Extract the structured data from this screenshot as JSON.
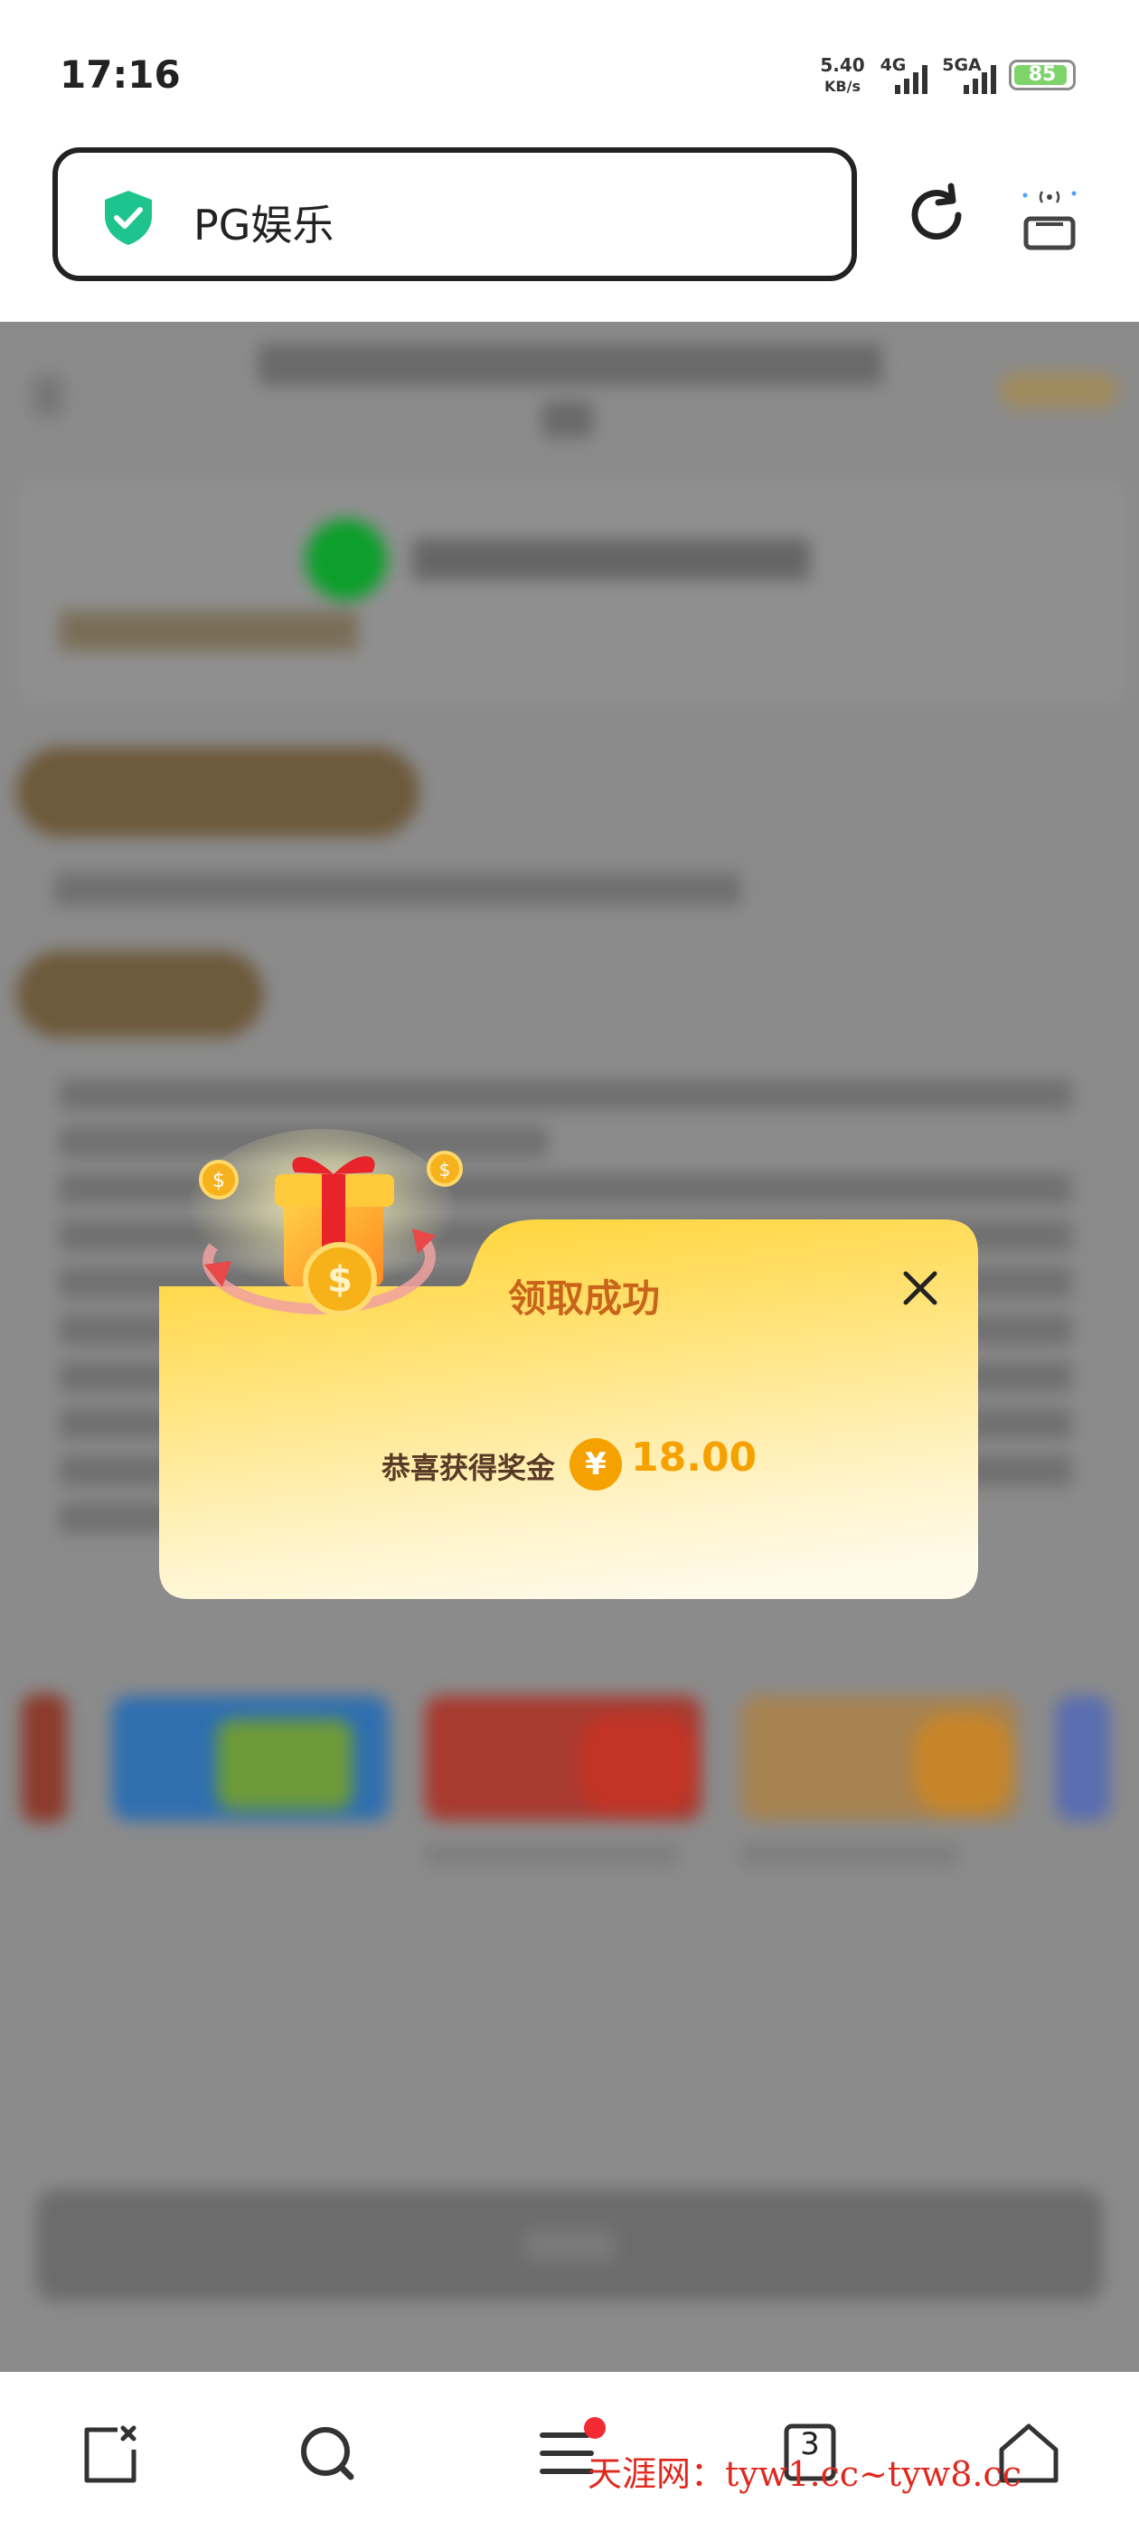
{
  "status_bar": {
    "time": "17:16",
    "net_speed_value": "5.40",
    "net_speed_unit": "KB/s",
    "network_4g": "4G",
    "network_5g": "5GA",
    "battery": "85"
  },
  "browser": {
    "address_text": "PG娱乐",
    "icons": [
      "shield-check-icon",
      "refresh-icon",
      "cast-icon"
    ]
  },
  "modal": {
    "title": "领取成功",
    "message": "恭喜获得奖金",
    "currency_symbol": "¥",
    "amount": "18.00",
    "colors": {
      "title": "#c8651a",
      "amount": "#f5a200",
      "header": "#ffd84a"
    }
  },
  "bottom_nav": {
    "tab_count": "3",
    "icons": [
      "close-page-icon",
      "search-icon",
      "menu-icon",
      "tabs-icon",
      "home-icon"
    ]
  },
  "watermark": "天涯网：tyw1.cc~tyw8.cc"
}
